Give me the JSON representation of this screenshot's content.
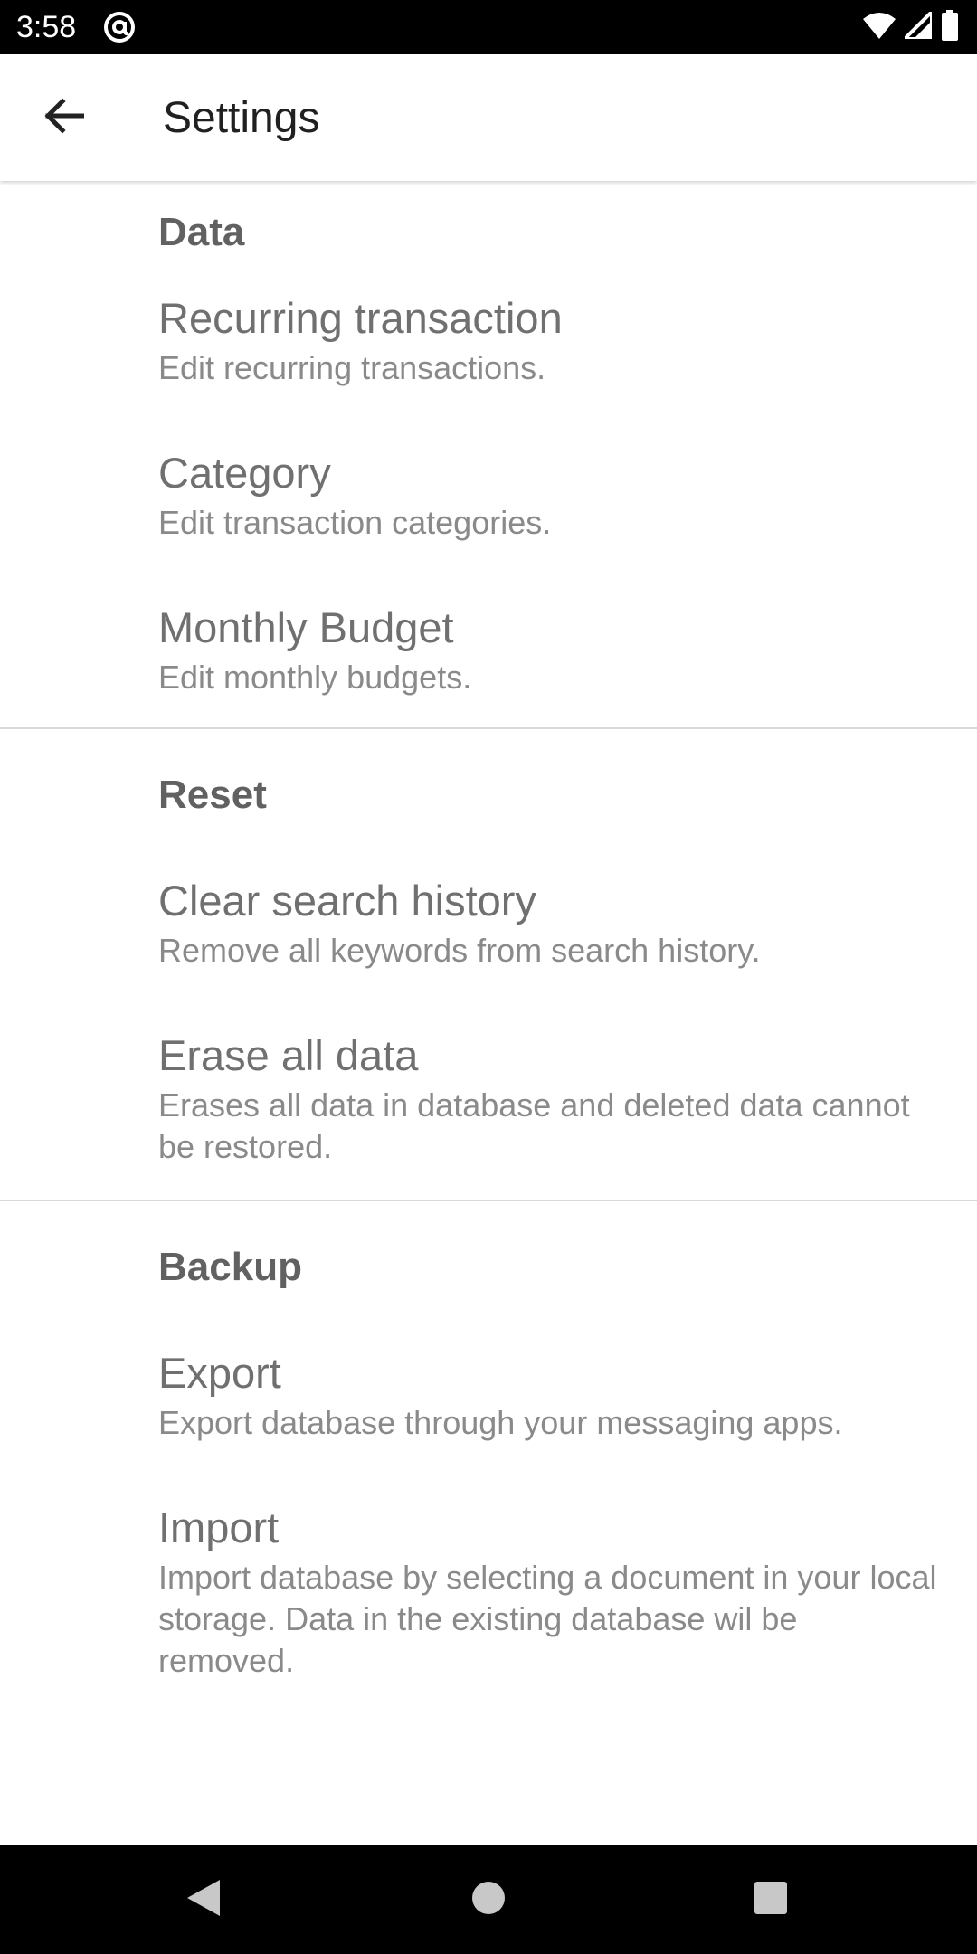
{
  "status_bar": {
    "time": "3:58",
    "app_icon": "at-sign-icon",
    "icons": [
      "wifi-icon",
      "signal-icon",
      "battery-icon"
    ]
  },
  "app_bar": {
    "back_icon": "arrow-back-icon",
    "title": "Settings"
  },
  "sections": [
    {
      "title": "Data",
      "items": [
        {
          "title": "Recurring transaction",
          "summary": "Edit recurring transactions."
        },
        {
          "title": "Category",
          "summary": "Edit transaction categories."
        },
        {
          "title": "Monthly Budget",
          "summary": "Edit monthly budgets."
        }
      ]
    },
    {
      "title": "Reset",
      "items": [
        {
          "title": "Clear search history",
          "summary": "Remove all keywords from search history."
        },
        {
          "title": "Erase all data",
          "summary": "Erases all data in database and deleted data cannot be restored."
        }
      ]
    },
    {
      "title": "Backup",
      "items": [
        {
          "title": "Export",
          "summary": "Export database through your messaging apps."
        },
        {
          "title": "Import",
          "summary": "Import database by selecting a document in your local storage. Data in the existing database wil be removed."
        }
      ]
    }
  ],
  "nav_bar": {
    "icons": [
      "back-triangle-icon",
      "home-circle-icon",
      "recents-square-icon"
    ]
  },
  "colors": {
    "status_bar": "#000000",
    "section_title": "#616161",
    "item_title": "#707070",
    "item_summary": "#8a8a8a",
    "divider": "#d9d9d9"
  }
}
